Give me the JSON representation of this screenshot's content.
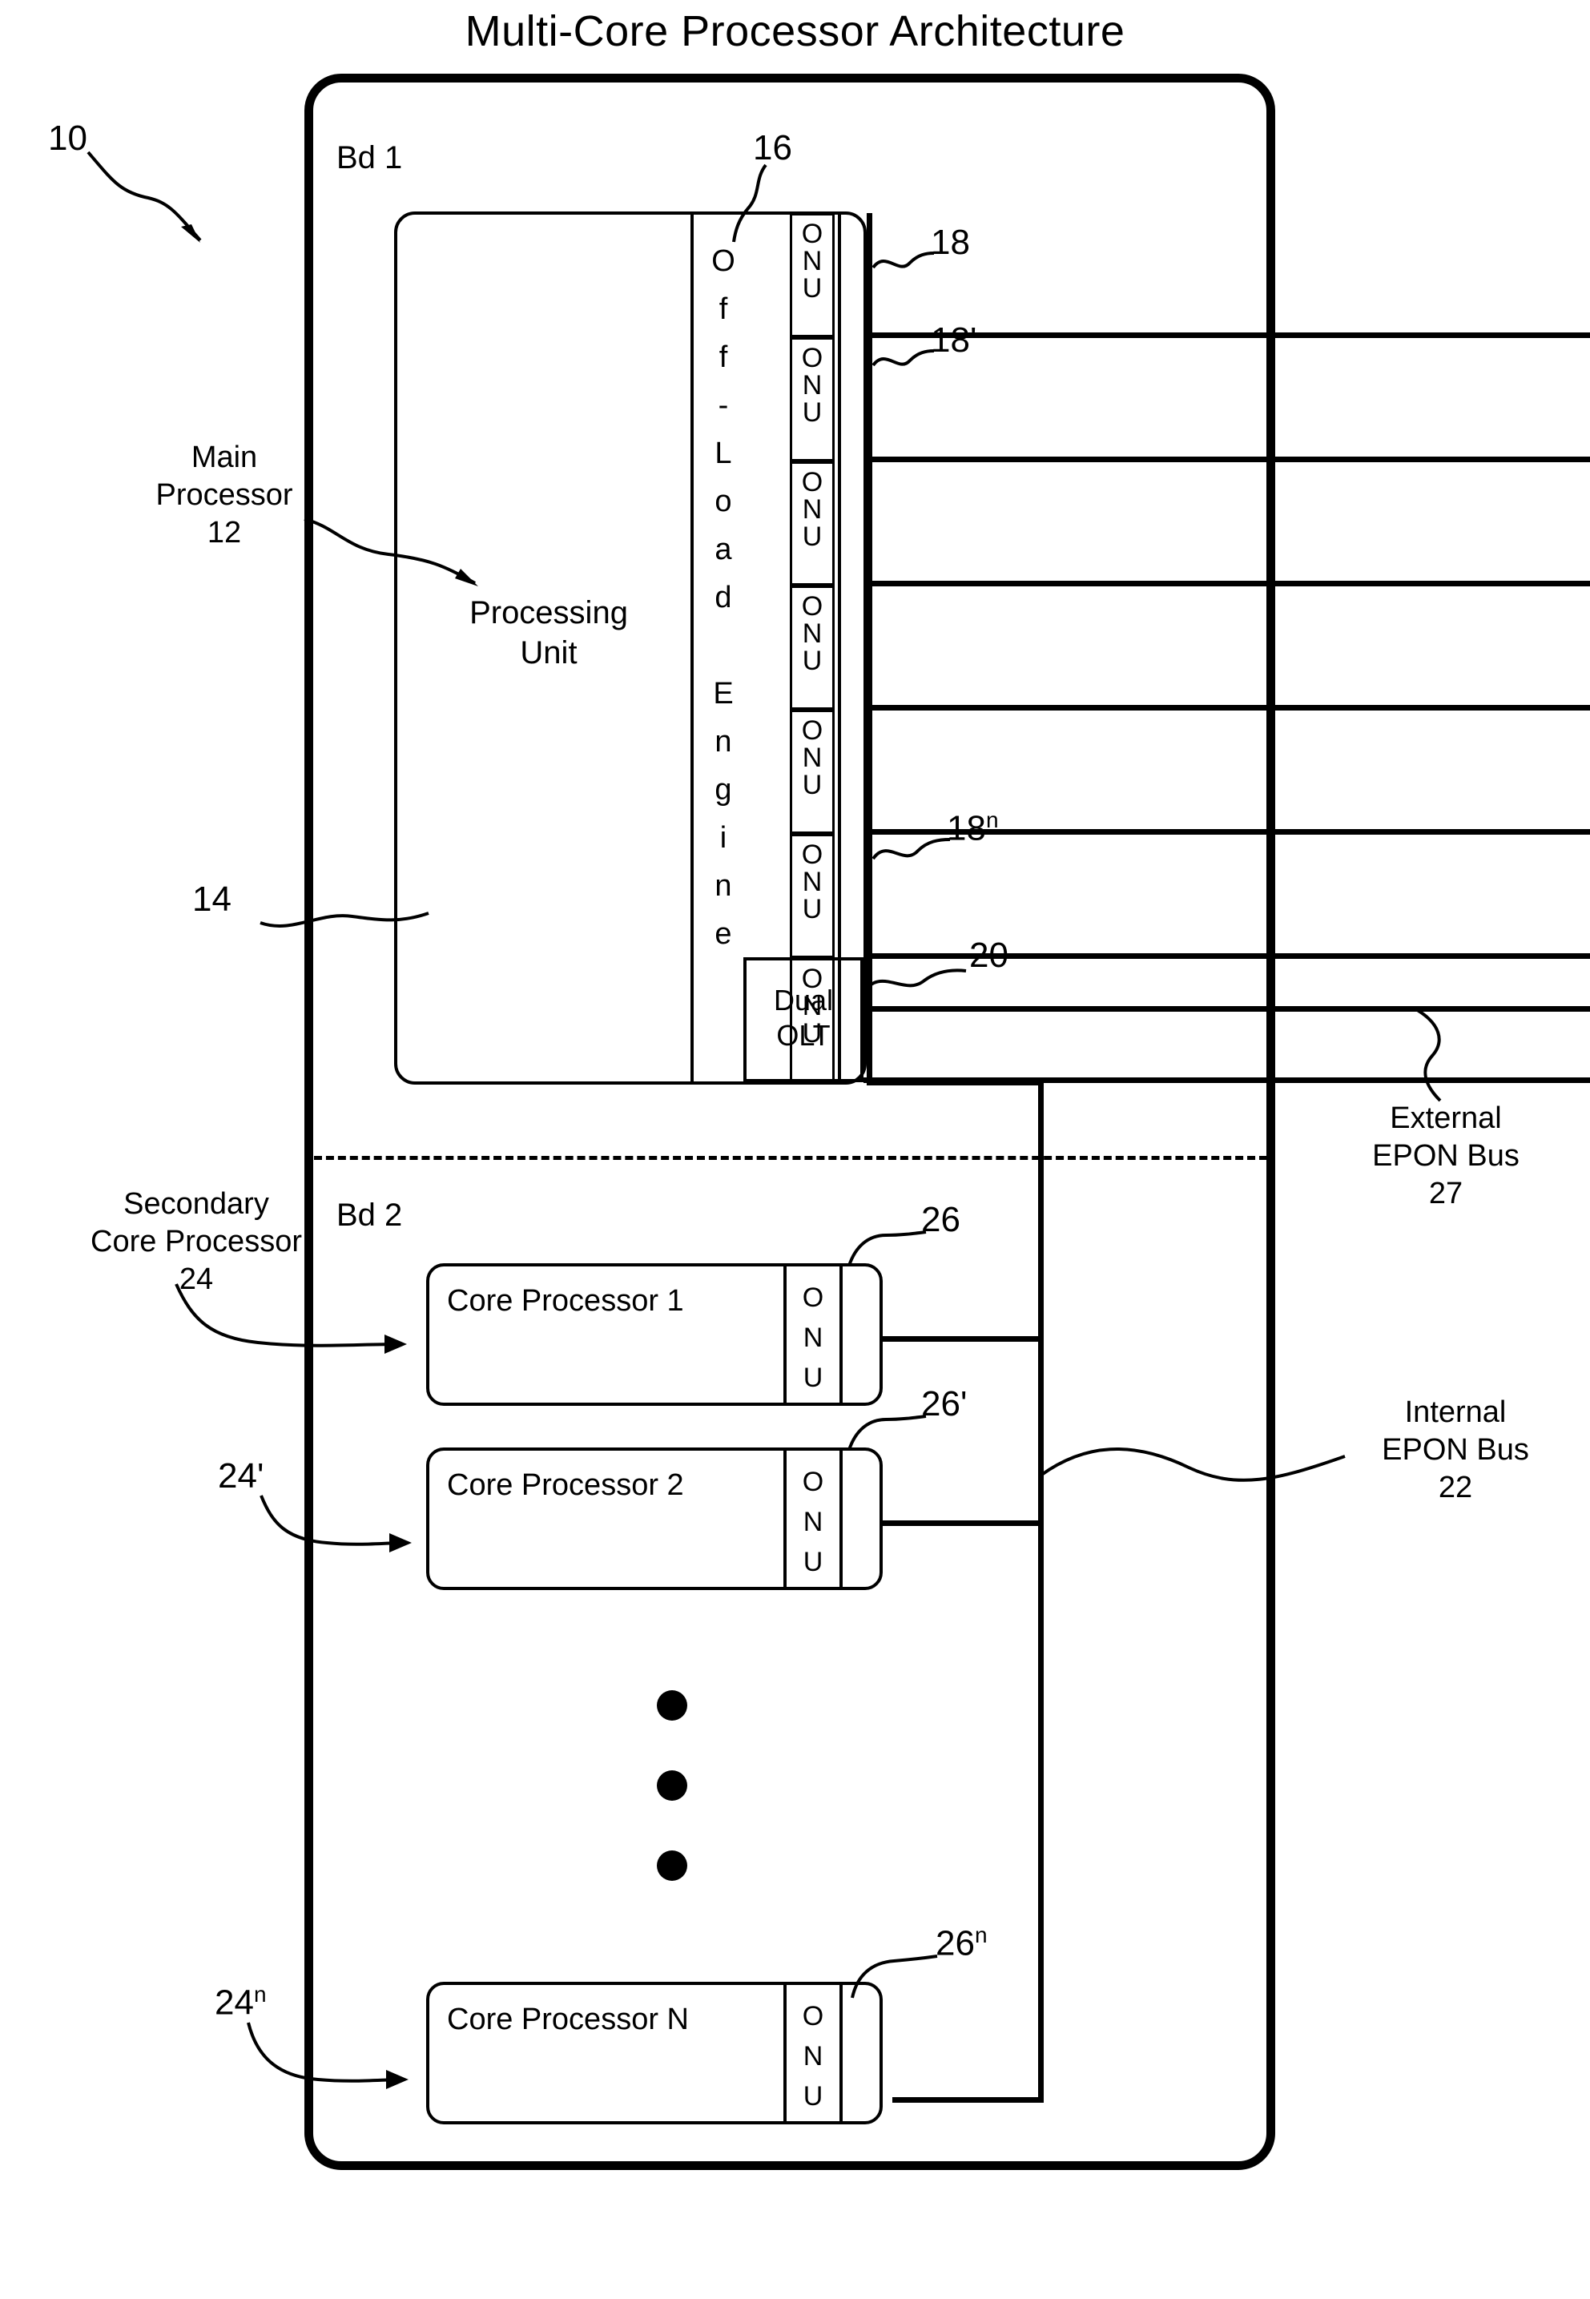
{
  "figure": {
    "title": "Multi-Core Processor Architecture",
    "system_ref": "10"
  },
  "board1": {
    "label": "Bd 1",
    "main_processor": {
      "side_label_line1": "Main",
      "side_label_line2": "Processor",
      "side_label_ref": "12",
      "outer_ref": "14",
      "processing_unit_line1": "Processing",
      "processing_unit_line2": "Unit",
      "offload_engine_text": "Off-Load Engine",
      "offload_engine_ref": "16",
      "onu_label": "ONU",
      "onu_count": 7,
      "onu_ref_first": "18",
      "onu_ref_second": "18'",
      "onu_ref_last_base": "18",
      "onu_ref_last_sup": "n"
    },
    "dual_olt": {
      "line1": "Dual",
      "line2": "OLT",
      "ref": "20"
    }
  },
  "board2": {
    "label": "Bd 2",
    "side_label_line1": "Secondary",
    "side_label_line2": "Core Processor",
    "side_label_ref": "24",
    "ref_second": "24'",
    "ref_last_base": "24",
    "ref_last_sup": "n",
    "core_processors": [
      {
        "name": "Core Processor 1",
        "onu_label": "ONU",
        "onu_ref": "26"
      },
      {
        "name": "Core Processor 2",
        "onu_label": "ONU",
        "onu_ref": "26'"
      },
      {
        "name": "Core Processor N",
        "onu_label": "ONU",
        "onu_ref_base": "26",
        "onu_ref_sup": "n"
      }
    ],
    "ellipsis_dots": 3
  },
  "buses": {
    "external": {
      "line1": "External",
      "line2": "EPON Bus",
      "ref": "27"
    },
    "internal": {
      "line1": "Internal",
      "line2": "EPON Bus",
      "ref": "22"
    }
  },
  "colors": {
    "ink": "#000000",
    "paper": "#ffffff"
  }
}
